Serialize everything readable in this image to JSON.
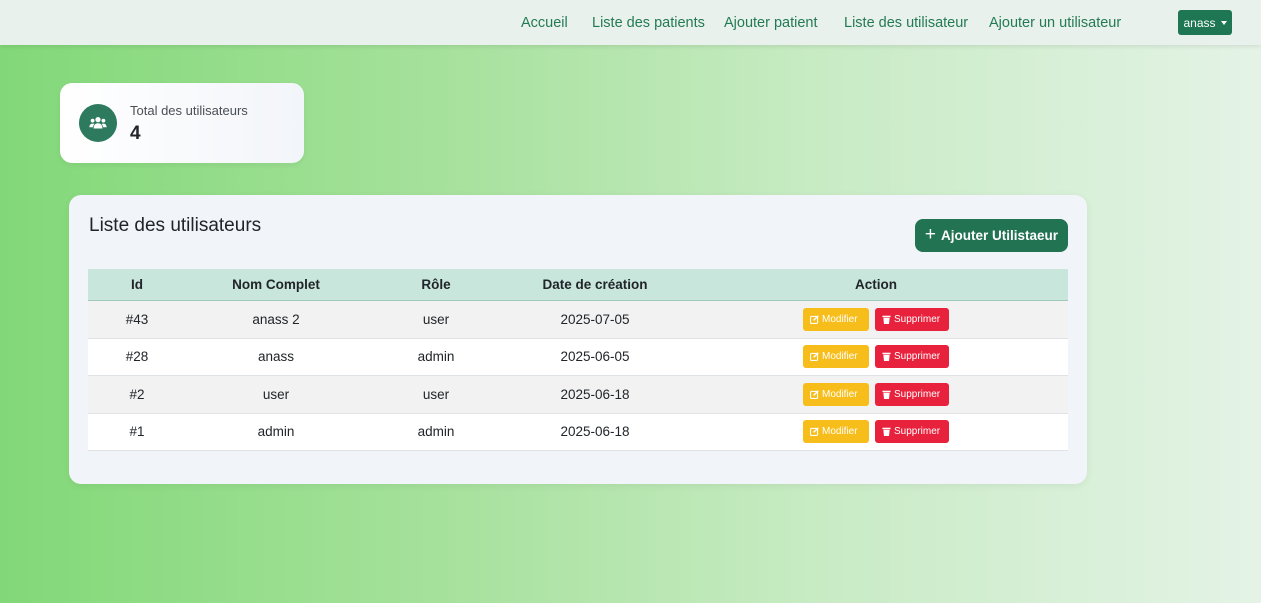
{
  "nav": {
    "links": [
      "Accueil",
      "Liste des patients",
      "Ajouter patient",
      "Liste des utilisateur",
      "Ajouter un utilisateur"
    ],
    "user": "anass"
  },
  "stats": {
    "label": "Total des utilisateurs",
    "value": "4"
  },
  "panel": {
    "title": "Liste des utilisateurs",
    "add_button": "Ajouter Utilistaeur"
  },
  "table": {
    "headers": [
      "Id",
      "Nom Complet",
      "Rôle",
      "Date de création",
      "Action"
    ],
    "rows": [
      {
        "id": "#43",
        "name": "anass 2",
        "role": "user",
        "date": "2025-07-05"
      },
      {
        "id": "#28",
        "name": "anass",
        "role": "admin",
        "date": "2025-06-05"
      },
      {
        "id": "#2",
        "name": "user",
        "role": "user",
        "date": "2025-06-18"
      },
      {
        "id": "#1",
        "name": "admin",
        "role": "admin",
        "date": "2025-06-18"
      }
    ],
    "edit_label": "Modifier",
    "delete_label": "Supprimer"
  },
  "colors": {
    "accent": "#227352",
    "edit": "#f7bd1a",
    "delete": "#e8223d"
  },
  "icons": {
    "stat": "users-icon",
    "add": "plus-icon",
    "edit": "edit-icon",
    "delete": "trash-icon",
    "user_menu": "caret-down-icon"
  }
}
